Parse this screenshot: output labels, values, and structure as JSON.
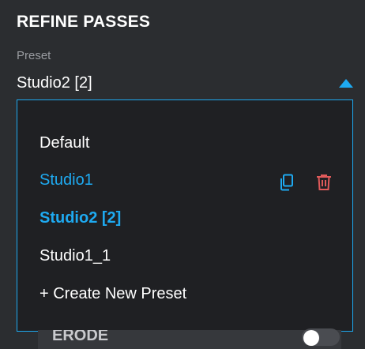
{
  "panel": {
    "title": "REFINE PASSES",
    "preset_label": "Preset",
    "selected_value": "Studio2 [2]"
  },
  "dropdown": {
    "options": [
      {
        "label": "Default"
      },
      {
        "label": "Studio1"
      },
      {
        "label": "Studio2 [2]"
      },
      {
        "label": "Studio1_1"
      },
      {
        "label": "+ Create New Preset"
      }
    ]
  },
  "below": {
    "label": "ERODE",
    "toggle_on": false
  },
  "colors": {
    "accent": "#1eaaf1",
    "delete": "#e05a5a",
    "background": "#2b2d30"
  }
}
